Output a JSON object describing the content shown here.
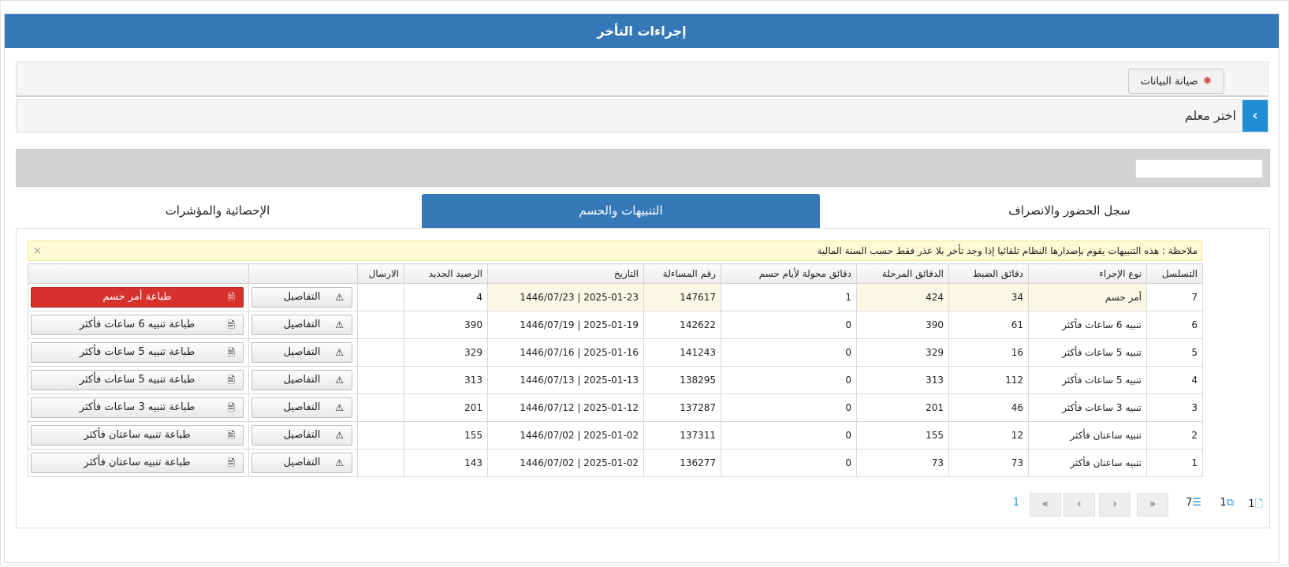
{
  "panel": {
    "title": "إجراءات التأخر"
  },
  "toolbar": {
    "maintenance_label": "صيانة البيانات",
    "gear_glyph": "✹"
  },
  "teacher": {
    "label": "اختر معلم",
    "arrow": "›"
  },
  "tabs": [
    {
      "label": "سجل الحضور والانصراف"
    },
    {
      "label": "التنبيهات والحسم"
    },
    {
      "label": "الإحصائية والمؤشرات"
    }
  ],
  "alert": {
    "text": "ملاحظة : هذه التنبيهات يقوم بإصدارها النظام تلقائيا إذا وجد تأخر بلا عذر فقط حسب السنة المالية",
    "close": "×"
  },
  "table": {
    "headers": [
      "التسلسل",
      "نوع الإجراء",
      "دقائق الضبط",
      "الدقائق المرحلة",
      "دقائق محولة لأيام حسم",
      "رقم المساءلة",
      "التاريخ",
      "الرصيد الجديد",
      "الارسال",
      "",
      ""
    ],
    "details_label": "التفاصيل",
    "rows": [
      {
        "seq": "7",
        "type": "أمر حسم",
        "minutes": "34",
        "carried": "424",
        "converted": "1",
        "inquiry": "147617",
        "date": "2025-01-23 | 1446/07/23",
        "balance": "4",
        "send": "",
        "print": "طباعة أمر حسم"
      },
      {
        "seq": "6",
        "type": "تنبيه 6 ساعات فأكثر",
        "minutes": "61",
        "carried": "390",
        "converted": "0",
        "inquiry": "142622",
        "date": "2025-01-19 | 1446/07/19",
        "balance": "390",
        "send": "",
        "print": "طباعة تنبيه 6 ساعات فأكثر"
      },
      {
        "seq": "5",
        "type": "تنبيه 5 ساعات فأكثر",
        "minutes": "16",
        "carried": "329",
        "converted": "0",
        "inquiry": "141243",
        "date": "2025-01-16 | 1446/07/16",
        "balance": "329",
        "send": "",
        "print": "طباعة تنبيه 5 ساعات فأكثر"
      },
      {
        "seq": "4",
        "type": "تنبيه 5 ساعات فأكثر",
        "minutes": "112",
        "carried": "313",
        "converted": "0",
        "inquiry": "138295",
        "date": "2025-01-13 | 1446/07/13",
        "balance": "313",
        "send": "",
        "print": "طباعة تنبيه 5 ساعات فأكثر"
      },
      {
        "seq": "3",
        "type": "تنبيه 3 ساعات فأكثر",
        "minutes": "46",
        "carried": "201",
        "converted": "0",
        "inquiry": "137287",
        "date": "2025-01-12 | 1446/07/12",
        "balance": "201",
        "send": "",
        "print": "طباعة تنبيه 3 ساعات فأكثر"
      },
      {
        "seq": "2",
        "type": "تنبيه ساعتان فأكثر",
        "minutes": "12",
        "carried": "155",
        "converted": "0",
        "inquiry": "137311",
        "date": "2025-01-02 | 1446/07/02",
        "balance": "155",
        "send": "",
        "print": "طباعة تنبيه ساعتان فأكثر"
      },
      {
        "seq": "1",
        "type": "تنبيه ساعتان فأكثر",
        "minutes": "73",
        "carried": "73",
        "converted": "0",
        "inquiry": "136277",
        "date": "2025-01-02 | 1446/07/02",
        "balance": "143",
        "send": "",
        "print": "طباعة تنبيه ساعتان فأكثر"
      }
    ]
  },
  "pager": {
    "current_page": "1",
    "pages_count": "1",
    "total_pages": "1",
    "records": "7",
    "first": "«",
    "prev": "‹",
    "next": "›",
    "last": "»"
  },
  "colors": {
    "header_blue": "#3478b7",
    "print_red": "#d6312c",
    "accent": "#1f8dd6"
  }
}
